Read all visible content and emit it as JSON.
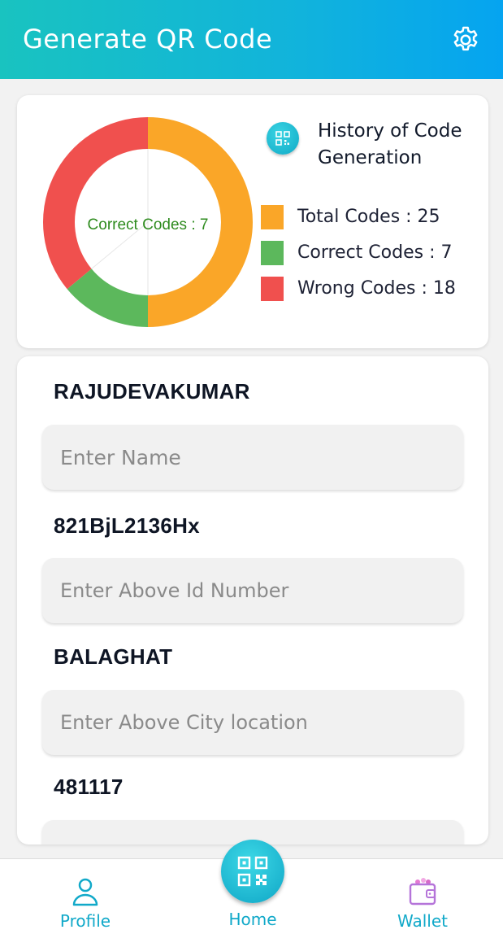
{
  "header": {
    "title": "Generate QR Code",
    "settings_icon": "gear-icon"
  },
  "stats": {
    "history_title": "History of Code Generation",
    "history_icon": "qr-code-icon",
    "center_label": "Correct Codes : 7",
    "legend": [
      {
        "label": "Total Codes : 25",
        "color": "#faa628"
      },
      {
        "label": "Correct Codes : 7",
        "color": "#5cb85c"
      },
      {
        "label": "Wrong Codes : 18",
        "color": "#f0504e"
      }
    ]
  },
  "chart_data": {
    "type": "pie",
    "title": "",
    "slices": [
      {
        "label": "Total Codes",
        "value": 25,
        "color": "#faa628"
      },
      {
        "label": "Correct Codes",
        "value": 7,
        "color": "#5cb85c"
      },
      {
        "label": "Wrong Codes",
        "value": 18,
        "color": "#f0504e"
      }
    ],
    "center_text": "Correct Codes : 7"
  },
  "form": {
    "name_value": "RAJUDEVAKUMAR",
    "name_placeholder": "Enter Name",
    "id_value": "821BjL2136Hx",
    "id_placeholder": "Enter Above Id Number",
    "city_value": "BALAGHAT",
    "city_placeholder": "Enter Above City location",
    "pin_value": "481117"
  },
  "nav": {
    "profile_label": "Profile",
    "home_label": "Home",
    "wallet_label": "Wallet"
  }
}
